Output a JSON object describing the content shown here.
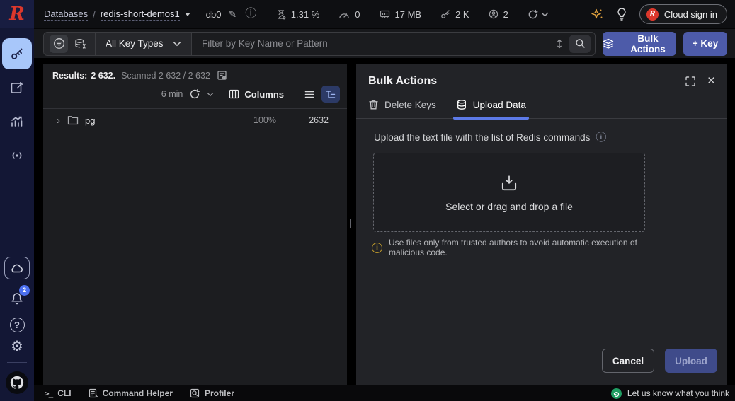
{
  "topbar": {
    "breadcrumb": {
      "root": "Databases",
      "separator": "/",
      "db": "redis-short-demos1",
      "db_index": "db0"
    },
    "stats": [
      {
        "name": "cpu-usage",
        "value": "1.31 %"
      },
      {
        "name": "commands-per-sec",
        "value": "0"
      },
      {
        "name": "memory",
        "value": "17 MB"
      },
      {
        "name": "total-keys",
        "value": "2 K"
      },
      {
        "name": "connected-clients",
        "value": "2"
      }
    ],
    "cloud_sign_in_label": "Cloud sign in"
  },
  "toolbar": {
    "key_type_selected": "All Key Types",
    "search_placeholder": "Filter by Key Name or Pattern",
    "bulk_actions_label": "Bulk Actions",
    "add_key_label": "+ Key"
  },
  "keys_panel": {
    "results_label": "Results:",
    "results_count": "2 632.",
    "scanned_text": "Scanned 2 632 / 2 632",
    "refresh_interval": "6 min",
    "columns_label": "Columns",
    "rows": [
      {
        "name": "pg",
        "percent": "100%",
        "count": "2632"
      }
    ]
  },
  "bulk_panel": {
    "title": "Bulk Actions",
    "tab_delete": "Delete Keys",
    "tab_upload": "Upload Data",
    "upload_hint": "Upload the text file with the list of Redis commands",
    "dropzone_label": "Select or drag and drop a file",
    "warning_text": "Use files only from trusted authors to avoid automatic execution of malicious code.",
    "cancel_label": "Cancel",
    "upload_label": "Upload"
  },
  "bottombar": {
    "cli_label": "CLI",
    "command_helper_label": "Command Helper",
    "profiler_label": "Profiler",
    "feedback_label": "Let us know what you think"
  },
  "sidebar": {
    "notifications_badge": "2"
  },
  "colors": {
    "accent_blue": "#4d5ba9",
    "active_tab_underline": "#5d7ae8",
    "sidebar_active_bg": "#a8c7fa",
    "sidebar_bg": "#131735",
    "redis_red": "#dc382c",
    "warning_yellow": "#c7a02c",
    "feedback_green": "#1f9d62",
    "panel_bg": "#222327"
  }
}
